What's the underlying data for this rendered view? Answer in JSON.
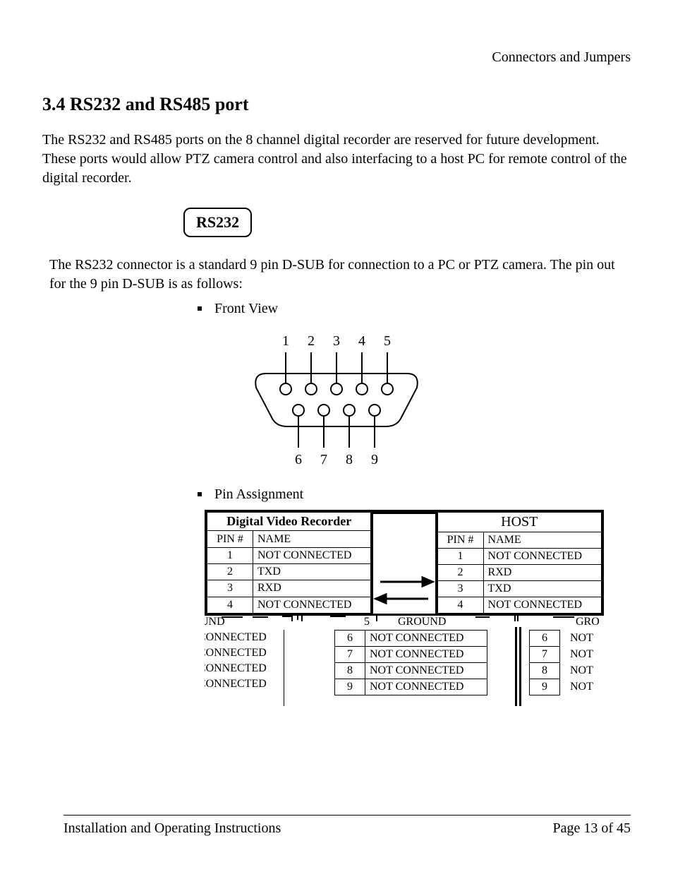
{
  "header_right": "Connectors and Jumpers",
  "title": "3.4 RS232 and RS485 port",
  "intro": "The RS232 and RS485 ports on the 8 channel digital recorder are reserved for future development. These ports would allow PTZ camera control and also interfacing to a host PC for remote control of the digital recorder.",
  "rs232_label": "RS232",
  "rs232_desc": "The RS232 connector is a standard 9 pin D-SUB for connection to a PC or PTZ camera. The pin out for the 9 pin D-SUB is as follows:",
  "bullet_front": "Front View",
  "bullet_pin": "Pin Assignment",
  "connector_pins_top": [
    "1",
    "2",
    "3",
    "4",
    "5"
  ],
  "connector_pins_bottom": [
    "6",
    "7",
    "8",
    "9"
  ],
  "dvr_title": "Digital Video Recorder",
  "host_title": "HOST",
  "col_pin": "PIN #",
  "col_name": "NAME",
  "dvr_rows": [
    {
      "pin": "1",
      "name": "NOT CONNECTED"
    },
    {
      "pin": "2",
      "name": "TXD"
    },
    {
      "pin": "3",
      "name": "RXD"
    },
    {
      "pin": "4",
      "name": "NOT CONNECTED"
    }
  ],
  "host_rows": [
    {
      "pin": "1",
      "name": "NOT CONNECTED"
    },
    {
      "pin": "2",
      "name": "RXD"
    },
    {
      "pin": "3",
      "name": "TXD"
    },
    {
      "pin": "4",
      "name": "NOT CONNECTED"
    }
  ],
  "mess": {
    "und_row": "UND",
    "ground_frag1": "5",
    "ground_frag2": "GROUND",
    "gro_frag": "GRO",
    "left_col": [
      "CONNECTED",
      "CONNECTED",
      "CONNECTED",
      "CONNECTED"
    ],
    "mid_nums": [
      "6",
      "7",
      "8",
      "9"
    ],
    "mid_names": [
      "NOT CONNECTED",
      "NOT CONNECTED",
      "NOT CONNECTED",
      "NOT CONNECTED"
    ],
    "right_nums": [
      "6",
      "7",
      "8",
      "9"
    ],
    "right_names": [
      "NOT",
      "NOT",
      "NOT",
      "NOT"
    ]
  },
  "footer_left": "Installation and Operating Instructions",
  "footer_right": "Page 13 of 45"
}
